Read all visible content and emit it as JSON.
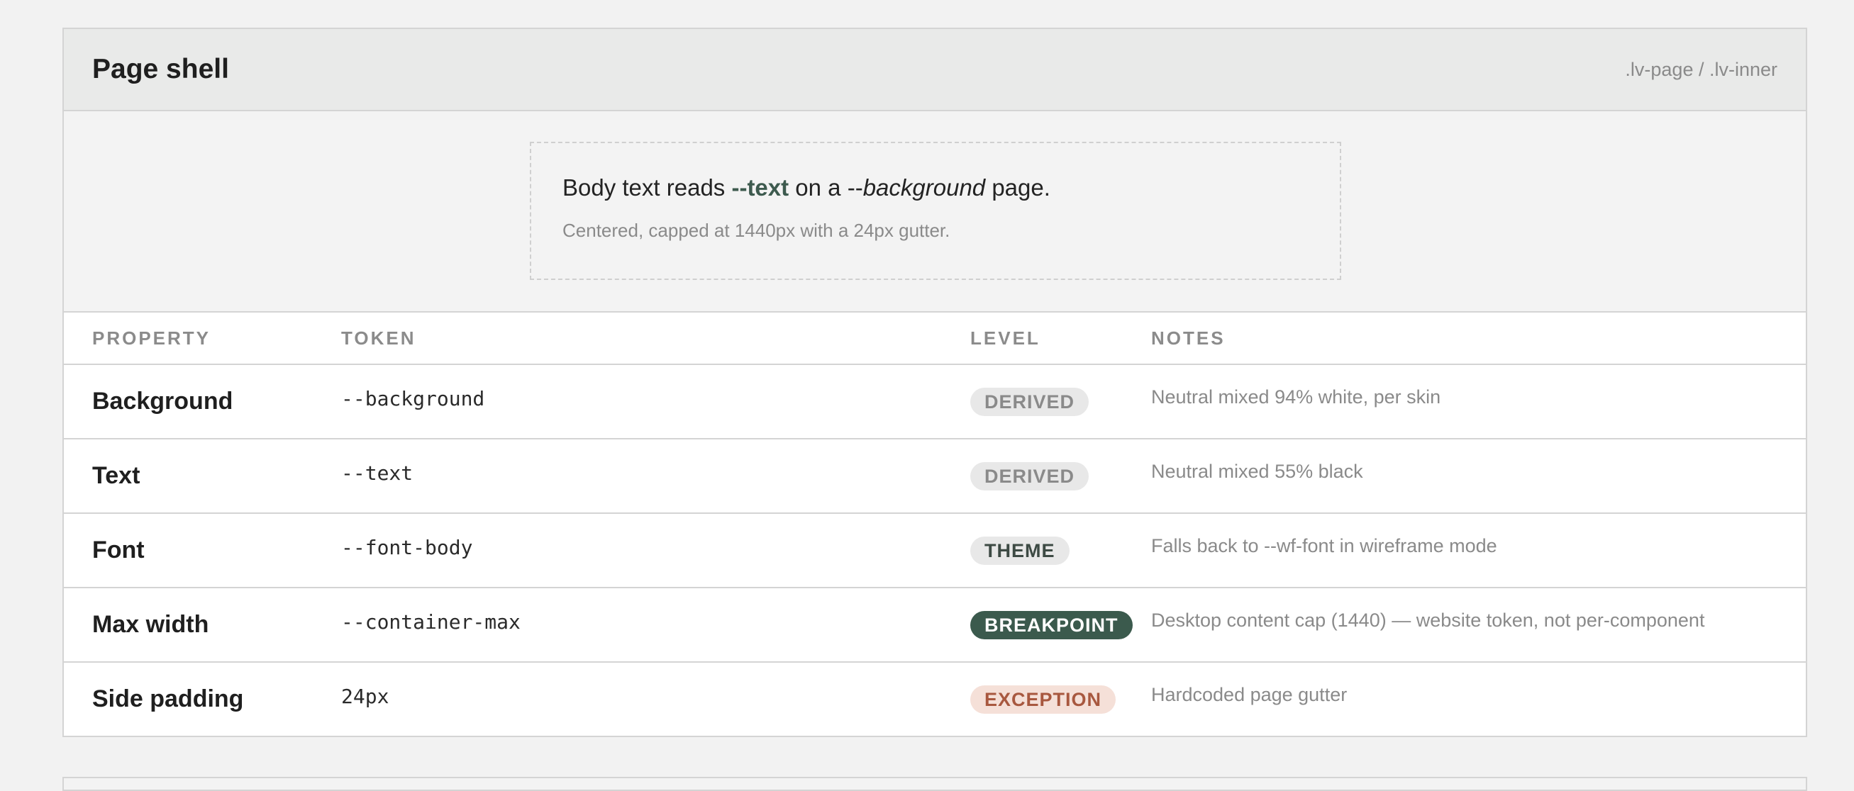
{
  "section": {
    "title": "Page shell",
    "classes": ".lv-page / .lv-inner"
  },
  "preview": {
    "line_prefix": "Body text reads ",
    "line_token_text": "--text",
    "line_middle": " on a --",
    "line_token_bg": "background",
    "line_suffix": " page.",
    "caption": "Centered, capped at 1440px with a 24px gutter."
  },
  "table": {
    "headers": [
      "PROPERTY",
      "TOKEN",
      "LEVEL",
      "NOTES"
    ],
    "rows": [
      {
        "property": "Background",
        "token": "--background",
        "level": "DERIVED",
        "note": "Neutral mixed 94% white, per skin"
      },
      {
        "property": "Text",
        "token": "--text",
        "level": "DERIVED",
        "note": "Neutral mixed 55% black"
      },
      {
        "property": "Font",
        "token": "--font-body",
        "level": "THEME",
        "note": "Falls back to --wf-font in wireframe mode"
      },
      {
        "property": "Max width",
        "token": "--container-max",
        "level": "BREAKPOINT",
        "note": "Desktop content cap (1440) — website token, not per-component"
      },
      {
        "property": "Side padding",
        "token": "24px",
        "level": "EXCEPTION",
        "note": "Hardcoded page gutter"
      }
    ]
  },
  "colors": {
    "derived_bg": "#e8e8e8",
    "derived_fg": "#8a8a8a",
    "theme_bg": "#e8e8e8",
    "theme_fg": "#3d4a44",
    "breakpoint_bg": "#3b5a4d",
    "breakpoint_fg": "#ffffff",
    "exception_bg": "#f5e0d8",
    "exception_fg": "#a8583f",
    "accent_text": "#3d5a4e"
  }
}
